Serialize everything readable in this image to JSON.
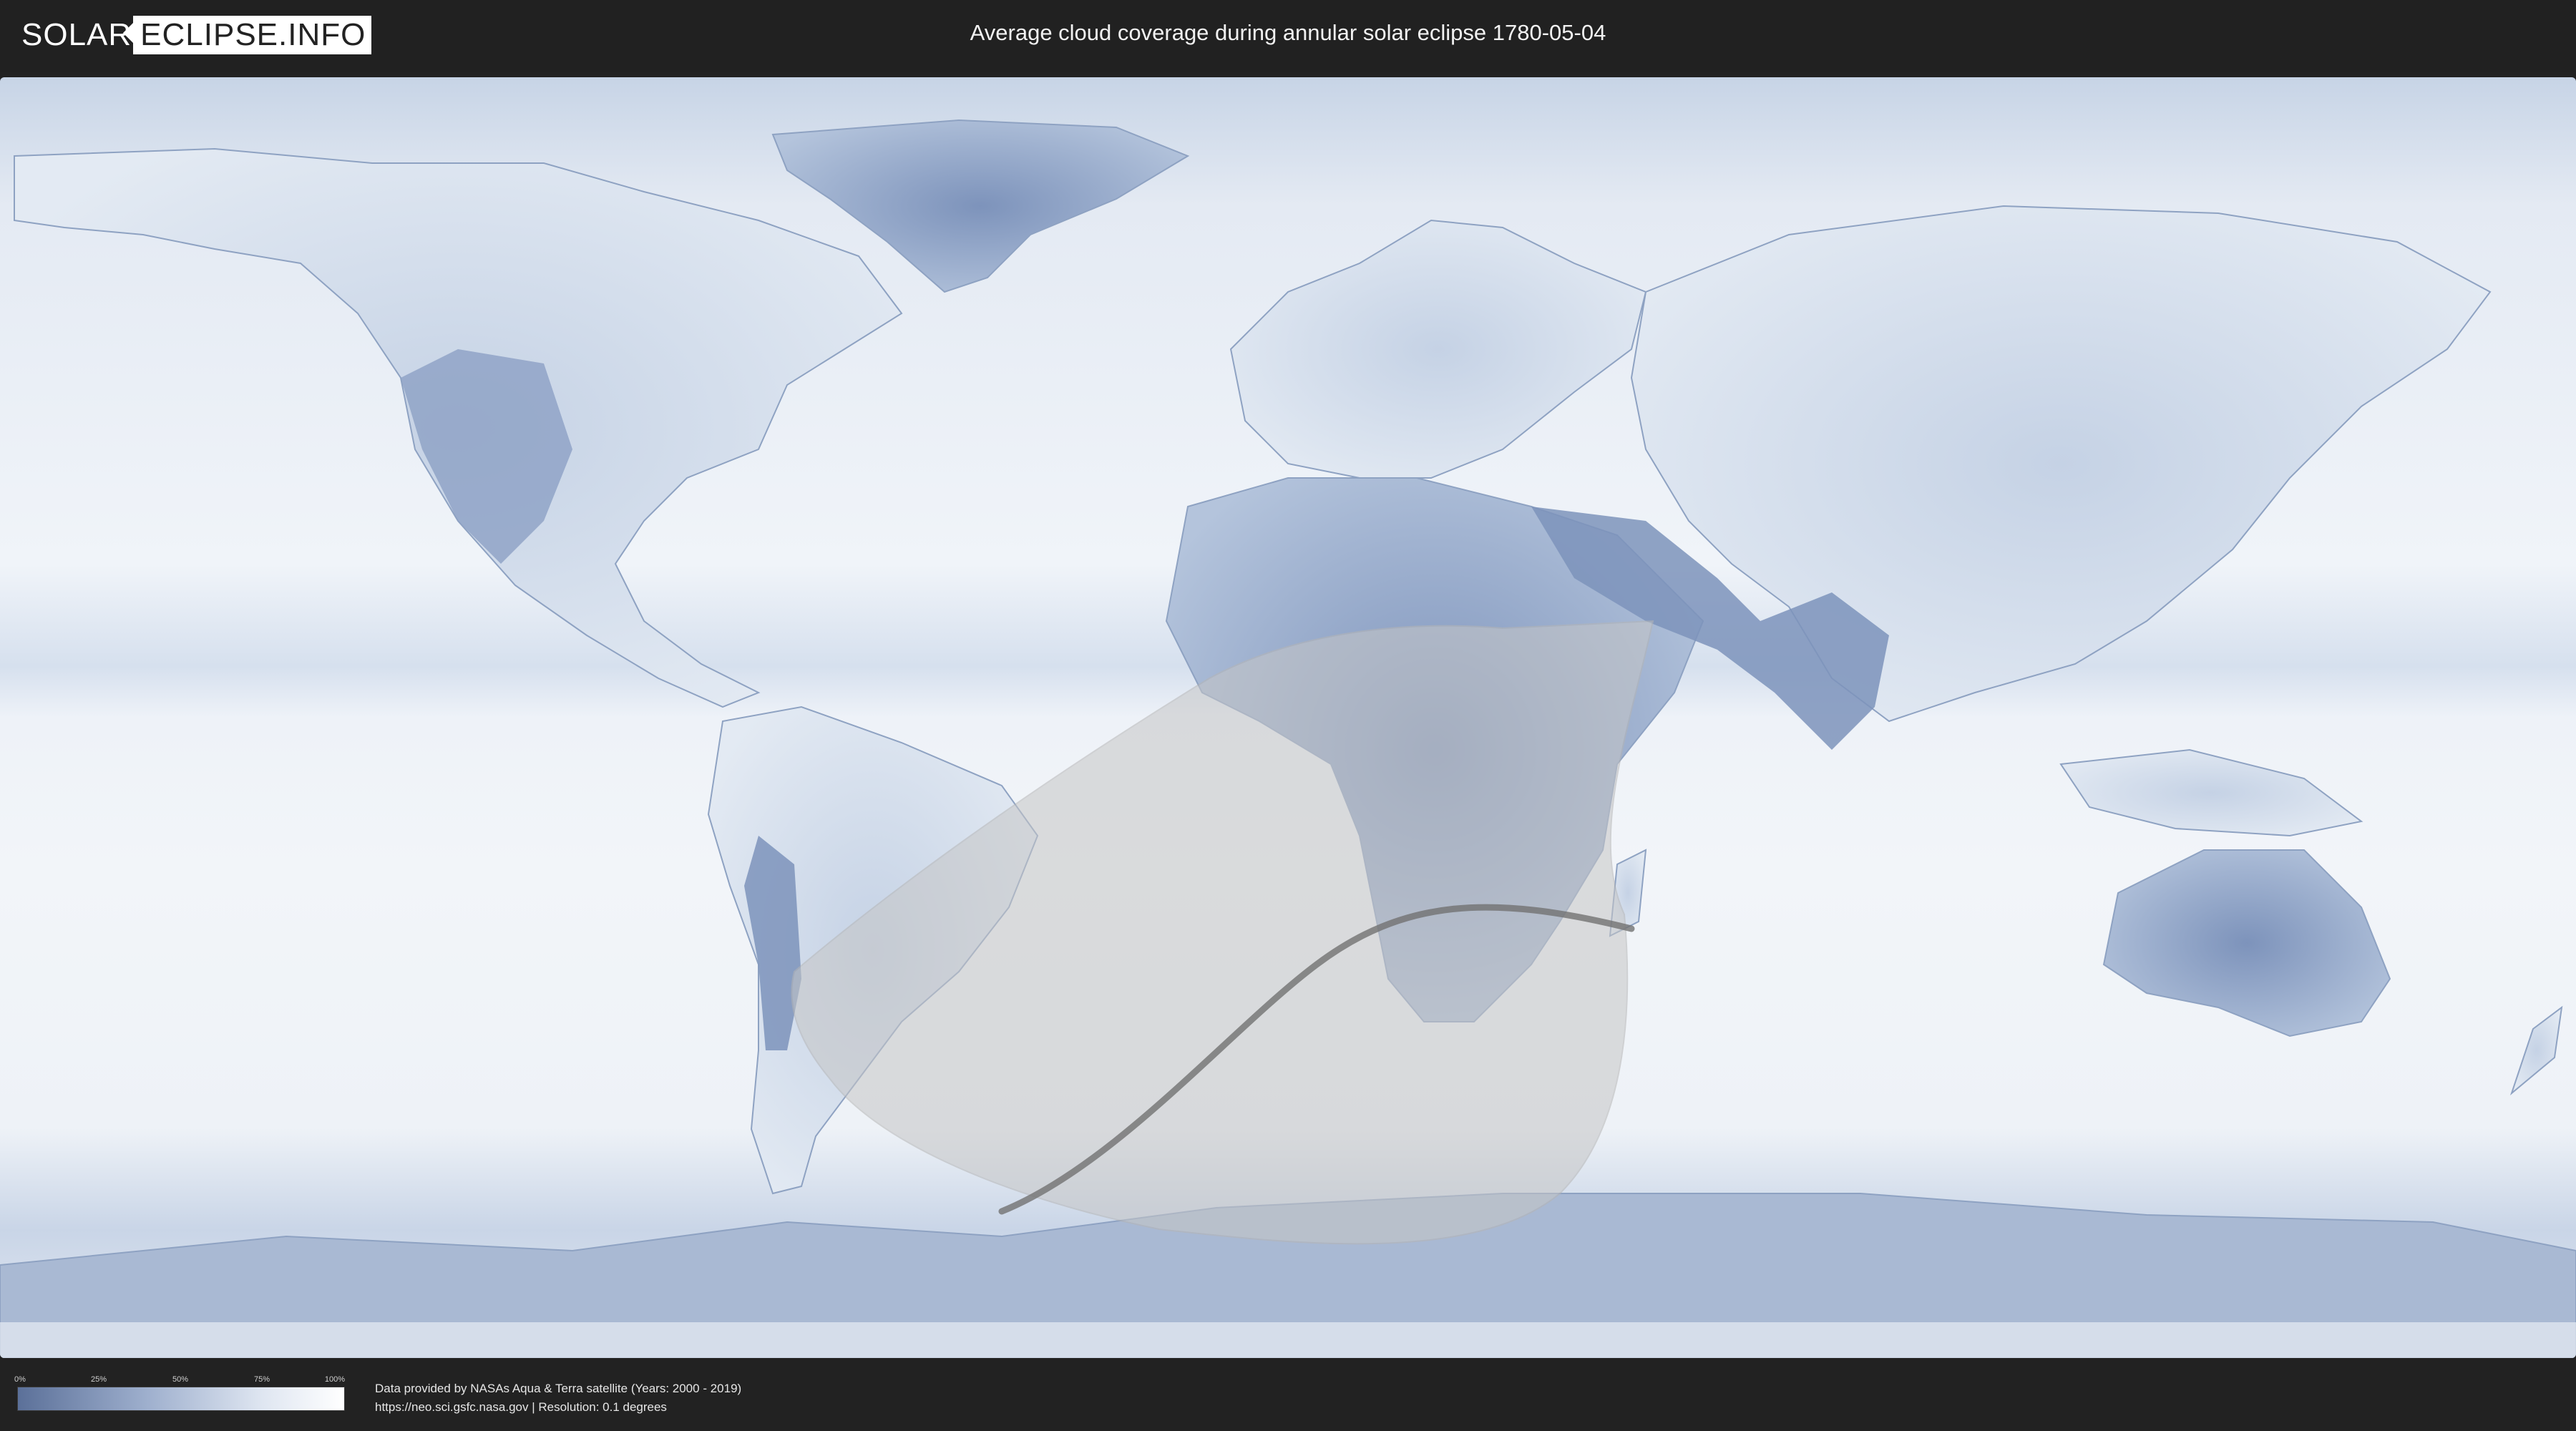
{
  "header": {
    "logo_left": "SOLAR",
    "logo_right": "ECLIPSE.INFO",
    "title": "Average cloud coverage during annular solar eclipse 1780-05-04"
  },
  "map": {
    "description_icon": "world-cloud-coverage-map",
    "colors": {
      "ocean_cloud": "#e9eef5",
      "land_clear": "#6f87b2",
      "eclipse_zone": "#c9c9c9",
      "path": "#707070"
    }
  },
  "legend": {
    "ticks": [
      "0%",
      "25%",
      "50%",
      "75%",
      "100%"
    ]
  },
  "credits": {
    "line1": "Data provided by NASAs Aqua & Terra satellite (Years: 2000 - 2019)",
    "line2": "https://neo.sci.gsfc.nasa.gov | Resolution: 0.1 degrees"
  }
}
